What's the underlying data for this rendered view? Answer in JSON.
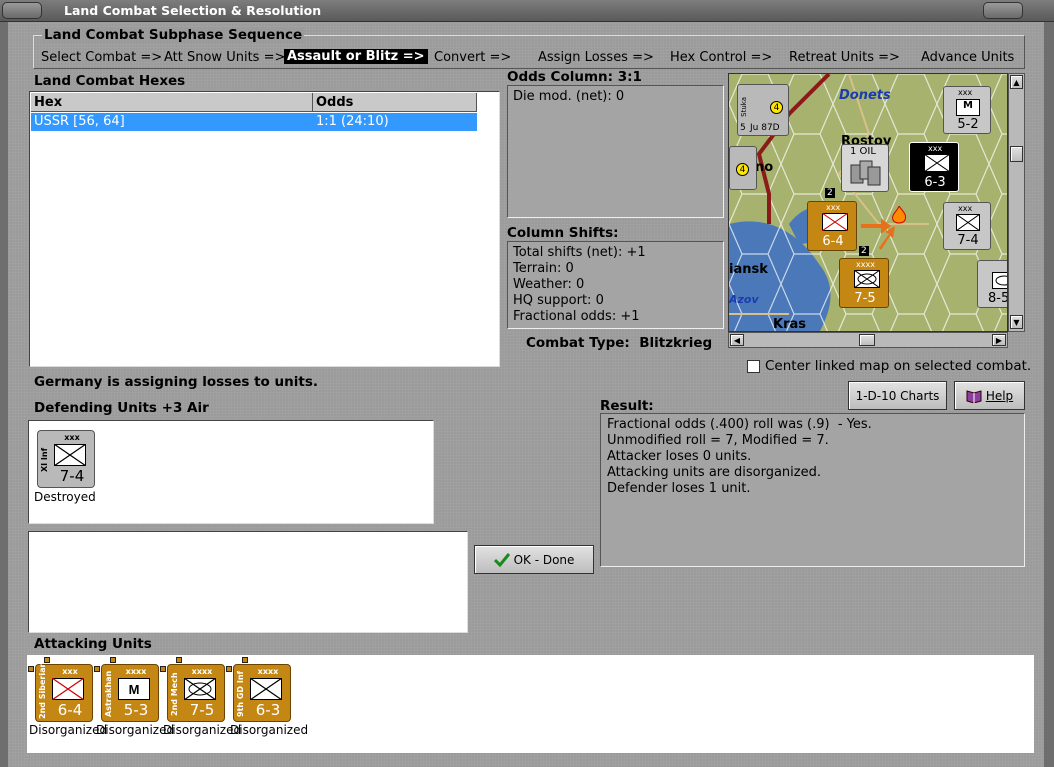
{
  "window": {
    "title": "Land Combat Selection & Resolution"
  },
  "subphase": {
    "title": "Land Combat Subphase Sequence",
    "steps": [
      "Select Combat =>",
      "Att Snow Units =>",
      "Assault or Blitz =>",
      "Convert =>",
      "Assign Losses =>",
      "Hex Control =>",
      "Retreat Units =>",
      "Advance Units"
    ],
    "active_index": 2
  },
  "hexes": {
    "title": "Land Combat Hexes",
    "columns": [
      "Hex",
      "Odds"
    ],
    "rows": [
      {
        "hex": "USSR [56, 64]",
        "odds": "1:1 (24:10)",
        "selected": true
      }
    ]
  },
  "odds": {
    "title": "Odds Column: 3:1",
    "die_mod": "Die mod. (net): 0"
  },
  "shifts": {
    "title": "Column Shifts:",
    "lines": [
      "Total shifts (net): +1",
      "Terrain: 0",
      "Weather: 0",
      "HQ support: 0",
      "Fractional odds: +1"
    ]
  },
  "combat_type": "Combat Type:  Blitzkrieg",
  "center_map": {
    "label": "Center linked map on selected combat.",
    "checked": false
  },
  "status_message": "Germany is assigning losses to units.",
  "defending": {
    "title": "Defending Units +3 Air",
    "units": [
      {
        "side_text": "XI Inf",
        "size": "xxx",
        "strength": "7-4",
        "caption": "Destroyed",
        "style": "gray"
      }
    ]
  },
  "buttons": {
    "charts": "1-D-10 Charts",
    "help": "Help",
    "ok": "OK - Done"
  },
  "result": {
    "title": "Result:",
    "lines": [
      "Fractional odds (.400) roll was (.9)  - Yes.",
      "Unmodified roll = 7, Modified = 7.",
      "Attacker loses 0 units.",
      "Attacking units are disorganized.",
      "Defender loses 1 unit."
    ]
  },
  "attacking": {
    "title": "Attacking Units",
    "units": [
      {
        "side_text": "2nd Siberian",
        "size": "xxx",
        "strength": "6-4",
        "caption": "Disorganized",
        "symbol": "infantry"
      },
      {
        "side_text": "Astrakhan",
        "size": "xxxx",
        "strength": "5-3",
        "caption": "Disorganized",
        "symbol": "mountain"
      },
      {
        "side_text": "2nd Mech",
        "size": "xxxx",
        "strength": "7-5",
        "caption": "Disorganized",
        "symbol": "mech"
      },
      {
        "side_text": "9th GD Inf",
        "size": "xxxx",
        "strength": "6-3",
        "caption": "Disorganized",
        "symbol": "infantry"
      }
    ]
  },
  "map": {
    "labels": [
      "Donets",
      "Rostov",
      "no",
      "iansk",
      "Azov",
      "Kras"
    ],
    "oil_label": "1 OIL",
    "counters": [
      {
        "strength": "5-2",
        "size": "xxx",
        "side": "Rsrv",
        "symbol": "M",
        "style": "gray"
      },
      {
        "strength": "6-3",
        "size": "xxx",
        "side": "VIII SS",
        "symbol": "infantry",
        "style": "black"
      },
      {
        "strength": "6-4",
        "size": "xxx",
        "side": "2nd Siberian",
        "symbol": "infantry",
        "style": "orange"
      },
      {
        "strength": "7-4",
        "size": "xxx",
        "side": "XI Inf",
        "symbol": "infantry",
        "style": "gray"
      },
      {
        "strength": "7-5",
        "size": "xxxx",
        "side": "2nd Mech",
        "symbol": "mech",
        "style": "orange"
      },
      {
        "strength": "8-5",
        "size": "",
        "side": "XI Arm",
        "symbol": "armor",
        "style": "gray"
      }
    ],
    "air_units": [
      {
        "name": "Stuka",
        "count": "4",
        "sub": "Ju 87D",
        "nums": "5"
      }
    ],
    "stack_counts": [
      "2",
      "2"
    ]
  },
  "colors": {
    "selection": "#3399ff",
    "counter_orange": "#c58713",
    "map_green": "#9fae6c",
    "sea": "#4a78b8",
    "front_line": "#8b1a1a"
  }
}
